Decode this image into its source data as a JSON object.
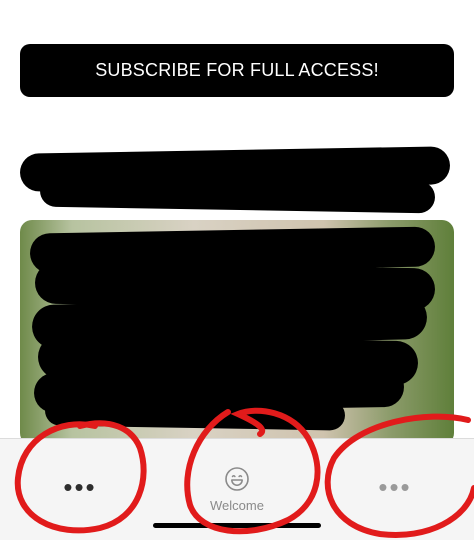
{
  "subscribe_banner": {
    "label": "SUBSCRIBE FOR FULL ACCESS!"
  },
  "tab_bar": {
    "left_tab": {
      "icon": "more-dots-icon",
      "symbol": "•••"
    },
    "center_tab": {
      "icon": "smile-icon",
      "label": "Welcome"
    },
    "right_tab": {
      "icon": "more-dots-icon",
      "symbol": "•••"
    }
  },
  "colors": {
    "banner_bg": "#000000",
    "banner_text": "#ffffff",
    "tab_bar_bg": "#f5f5f5",
    "annotation_red": "#e11b1b"
  }
}
